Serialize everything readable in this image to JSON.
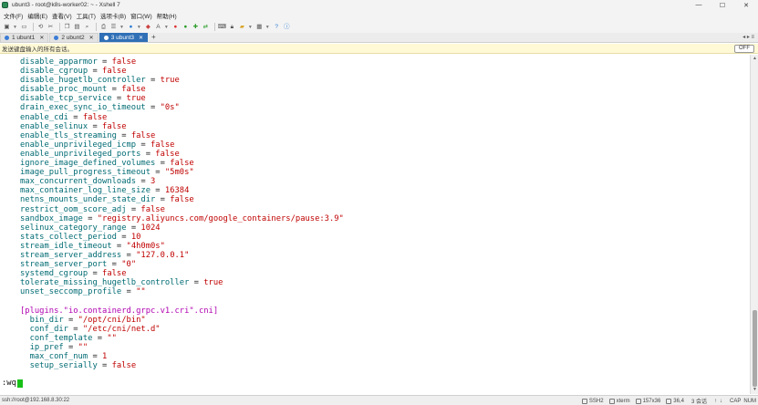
{
  "window": {
    "title": "ubunt3 - root@k8s-worker02: ~ - Xshell 7",
    "controls": [
      "—",
      "☐",
      "✕"
    ]
  },
  "menu": [
    "文件(F)",
    "编辑(E)",
    "查看(V)",
    "工具(T)",
    "选项卡(B)",
    "窗口(W)",
    "帮助(H)"
  ],
  "toolbar": {
    "icons": [
      "new-session-icon",
      "open-folder-icon",
      "reconnect-icon",
      "disconnect-icon",
      "copy-icon",
      "paste-icon",
      "find-icon",
      "print-icon",
      "properties-icon",
      "globe-icon",
      "color-scheme-icon",
      "font-icon",
      "xftp-icon",
      "script-icon",
      "tunnel-icon",
      "transfer-icon",
      "keyboard-icon",
      "layout-icon",
      "help-icon",
      "info-icon"
    ]
  },
  "tabs": [
    {
      "label": "1 ubunt1",
      "active": false
    },
    {
      "label": "2 ubunt2",
      "active": false
    },
    {
      "label": "3 ubunt3",
      "active": true
    }
  ],
  "tab_add_label": "+",
  "tab_nav": "◂ ▸ ≡",
  "compose_bar": {
    "text": "发送键盘输入的所有会话。",
    "toggle_label": "OFF"
  },
  "terminal": {
    "lines": [
      {
        "key": "disable_apparmor",
        "value": "false",
        "vtype": "bool"
      },
      {
        "key": "disable_cgroup",
        "value": "false",
        "vtype": "bool"
      },
      {
        "key": "disable_hugetlb_controller",
        "value": "true",
        "vtype": "bool"
      },
      {
        "key": "disable_proc_mount",
        "value": "false",
        "vtype": "bool"
      },
      {
        "key": "disable_tcp_service",
        "value": "true",
        "vtype": "bool"
      },
      {
        "key": "drain_exec_sync_io_timeout",
        "value": "\"0s\"",
        "vtype": "str"
      },
      {
        "key": "enable_cdi",
        "value": "false",
        "vtype": "bool"
      },
      {
        "key": "enable_selinux",
        "value": "false",
        "vtype": "bool"
      },
      {
        "key": "enable_tls_streaming",
        "value": "false",
        "vtype": "bool"
      },
      {
        "key": "enable_unprivileged_icmp",
        "value": "false",
        "vtype": "bool"
      },
      {
        "key": "enable_unprivileged_ports",
        "value": "false",
        "vtype": "bool"
      },
      {
        "key": "ignore_image_defined_volumes",
        "value": "false",
        "vtype": "bool"
      },
      {
        "key": "image_pull_progress_timeout",
        "value": "\"5m0s\"",
        "vtype": "str"
      },
      {
        "key": "max_concurrent_downloads",
        "value": "3",
        "vtype": "num"
      },
      {
        "key": "max_container_log_line_size",
        "value": "16384",
        "vtype": "num"
      },
      {
        "key": "netns_mounts_under_state_dir",
        "value": "false",
        "vtype": "bool"
      },
      {
        "key": "restrict_oom_score_adj",
        "value": "false",
        "vtype": "bool"
      },
      {
        "key": "sandbox_image",
        "value": "\"registry.aliyuncs.com/google_containers/pause:3.9\"",
        "vtype": "str"
      },
      {
        "key": "selinux_category_range",
        "value": "1024",
        "vtype": "num"
      },
      {
        "key": "stats_collect_period",
        "value": "10",
        "vtype": "num"
      },
      {
        "key": "stream_idle_timeout",
        "value": "\"4h0m0s\"",
        "vtype": "str"
      },
      {
        "key": "stream_server_address",
        "value": "\"127.0.0.1\"",
        "vtype": "str"
      },
      {
        "key": "stream_server_port",
        "value": "\"0\"",
        "vtype": "str"
      },
      {
        "key": "systemd_cgroup",
        "value": "false",
        "vtype": "bool"
      },
      {
        "key": "tolerate_missing_hugetlb_controller",
        "value": "true",
        "vtype": "bool"
      },
      {
        "key": "unset_seccomp_profile",
        "value": "\"\"",
        "vtype": "str"
      },
      {
        "blank": true
      },
      {
        "section": "[plugins.\"io.containerd.grpc.v1.cri\".cni]"
      },
      {
        "key": "bin_dir",
        "value": "\"/opt/cni/bin\"",
        "vtype": "str",
        "indent": 2
      },
      {
        "key": "conf_dir",
        "value": "\"/etc/cni/net.d\"",
        "vtype": "str",
        "indent": 2
      },
      {
        "key": "conf_template",
        "value": "\"\"",
        "vtype": "str",
        "indent": 2
      },
      {
        "key": "ip_pref",
        "value": "\"\"",
        "vtype": "str",
        "indent": 2
      },
      {
        "key": "max_conf_num",
        "value": "1",
        "vtype": "num",
        "indent": 2
      },
      {
        "key": "setup_serially",
        "value": "false",
        "vtype": "bool",
        "indent": 2
      }
    ],
    "command": ":wq"
  },
  "statusbar": {
    "connection": "ssh://root@192.168.8.30:22",
    "protocol": "SSH2",
    "terminal_type": "xterm",
    "size": "157x36",
    "cursor_pos": "36,4",
    "sessions": "3 会话",
    "caps": "CAP",
    "num": "NUM"
  }
}
